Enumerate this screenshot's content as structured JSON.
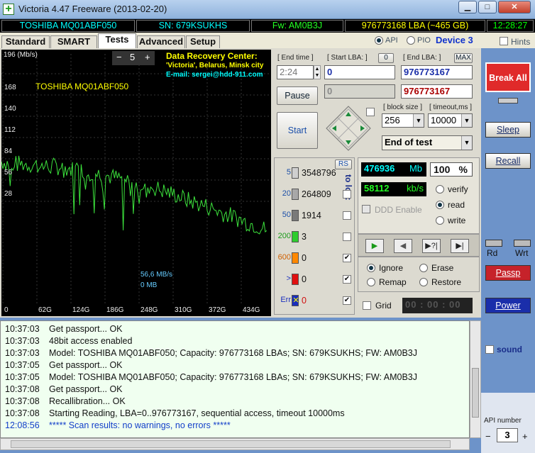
{
  "window": {
    "title": "Victoria 4.47  Freeware (2013-02-20)",
    "minimize": "▁",
    "maximize": "□",
    "close": "✕"
  },
  "info": {
    "model": "TOSHIBA MQ01ABF050",
    "serial": "SN: 679KSUKHS",
    "firmware": "Fw: AM0B3J",
    "lba": "976773168 LBA (~465 GB)",
    "clock": "12:28:27"
  },
  "tabs": [
    "Standard",
    "SMART",
    "Tests",
    "Advanced",
    "Setup"
  ],
  "mode": {
    "api": "API",
    "pio": "PIO",
    "device": "Device 3",
    "hints": "Hints"
  },
  "graph": {
    "y_unit": "196 (Mb/s)",
    "y_ticks": [
      "168",
      "140",
      "112",
      "84",
      "56",
      "28"
    ],
    "x_ticks": [
      "0",
      "62G",
      "124G",
      "186G",
      "248G",
      "310G",
      "372G",
      "434G"
    ],
    "zoom": "5",
    "zoom_minus": "−",
    "zoom_plus": "+",
    "dr_title": "Data Recovery Center:",
    "dr_line1": "'Victoria', Belarus, Minsk city",
    "dr_line2": "E-mail: sergei@hdd-911.com",
    "model": "TOSHIBA MQ01ABF050",
    "speed": "56,6 MB/s",
    "position": "0 MB"
  },
  "chart_data": {
    "type": "line",
    "title": "",
    "ylabel": "Mb/s",
    "ylim": [
      0,
      196
    ],
    "xlim": [
      0,
      465
    ],
    "series": [
      {
        "name": "",
        "x": [
          0,
          20,
          40,
          60,
          80,
          100,
          120,
          140,
          160,
          180,
          200,
          220,
          240,
          260,
          280,
          300,
          320,
          340,
          360,
          380,
          400,
          420,
          440,
          460
        ],
        "values": [
          112,
          110,
          110,
          109,
          108,
          108,
          106,
          105,
          103,
          101,
          99,
          97,
          94,
          92,
          89,
          86,
          82,
          79,
          76,
          72,
          69,
          65,
          62,
          58
        ]
      }
    ]
  },
  "controls": {
    "end_time_label": "[ End time ]",
    "end_time": "2:24",
    "start_lba_label": "[ Start LBA: ]",
    "start_lba_btn": "0",
    "start_lba": "0",
    "end_lba_label": "[ End LBA: ]",
    "end_lba_btn": "MAX",
    "end_lba": "976773167",
    "pause": "Pause",
    "cur_lba": "0",
    "cur_end_lba": "976773167",
    "start": "Start",
    "block_size_label": "[ block size ]",
    "block_size": "256",
    "timeout_label": "[ timeout,ms ]",
    "timeout": "10000",
    "end_action": "End of test"
  },
  "blocks": {
    "rs": "RS",
    "to_log": "to log:",
    "rows": [
      {
        "label": "5",
        "count": "3548796"
      },
      {
        "label": "20",
        "count": "264809"
      },
      {
        "label": "50",
        "count": "1914"
      },
      {
        "label": "200",
        "count": "3"
      },
      {
        "label": "600",
        "count": "0"
      },
      {
        "label": ">",
        "count": "0"
      },
      {
        "label": "Err",
        "count": "0"
      }
    ],
    "err_mark": "✕"
  },
  "stats": {
    "mb": "476936",
    "mb_unit": "Mb",
    "percent": "100",
    "percent_unit": "%",
    "speed": "58112",
    "speed_unit": "kb/s",
    "ddd": "DDD Enable",
    "verify": "verify",
    "read": "read",
    "write": "write"
  },
  "player": {
    "play": "▶",
    "back": "◀",
    "skip": "▶?|",
    "end": "▶|"
  },
  "errmode": {
    "ignore": "Ignore",
    "erase": "Erase",
    "remap": "Remap",
    "restore": "Restore"
  },
  "grid": {
    "label": "Grid",
    "timer": "00 : 00 : 00"
  },
  "log": [
    {
      "time": "10:37:03",
      "msg": "Get passport... OK"
    },
    {
      "time": "10:37:03",
      "msg": "48bit access enabled"
    },
    {
      "time": "10:37:03",
      "msg": "Model: TOSHIBA MQ01ABF050; Capacity: 976773168 LBAs; SN: 679KSUKHS; FW: AM0B3J"
    },
    {
      "time": "10:37:05",
      "msg": "Get passport... OK"
    },
    {
      "time": "10:37:05",
      "msg": "Model: TOSHIBA MQ01ABF050; Capacity: 976773168 LBAs; SN: 679KSUKHS; FW: AM0B3J"
    },
    {
      "time": "10:37:08",
      "msg": "Get passport... OK"
    },
    {
      "time": "10:37:08",
      "msg": "Recallibration... OK"
    },
    {
      "time": "10:37:08",
      "msg": "Starting Reading, LBA=0..976773167, sequential access, timeout 10000ms"
    },
    {
      "time": "12:08:56",
      "msg": "***** Scan results: no warnings, no errors *****"
    }
  ],
  "side": {
    "break_all": "Break All",
    "sleep": "Sleep",
    "recall": "Recall",
    "rd": "Rd",
    "wrt": "Wrt",
    "passp": "Passp",
    "power": "Power",
    "sound": "sound",
    "api_number_label": "API number",
    "api_number": "3",
    "minus": "−",
    "plus": "+"
  }
}
